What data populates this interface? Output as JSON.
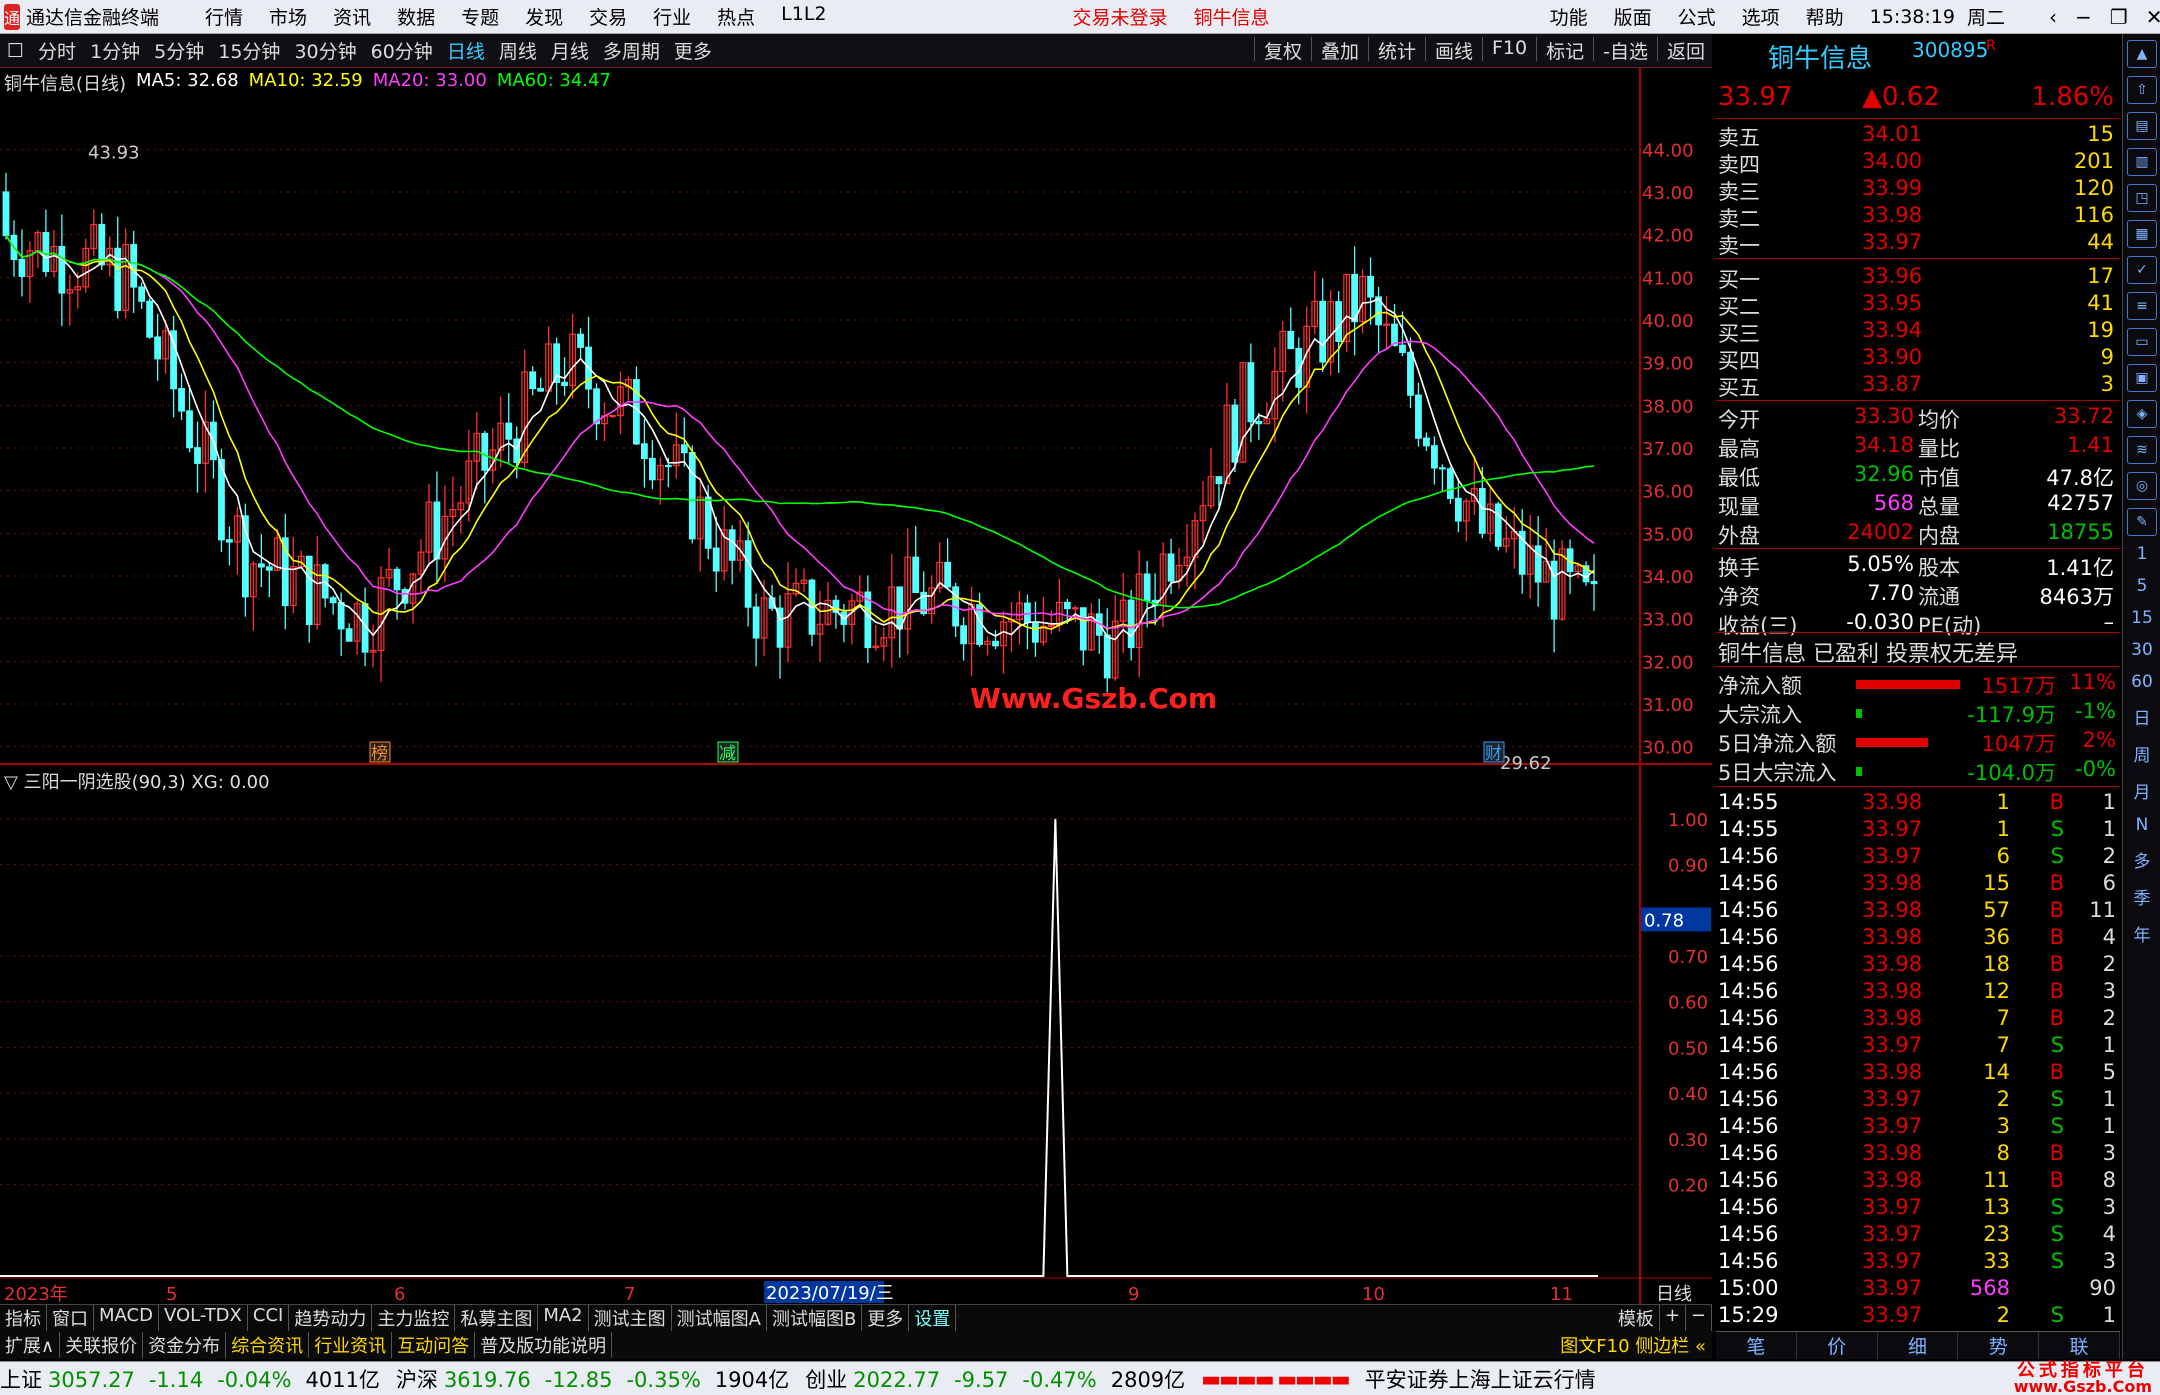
{
  "menubar": {
    "app_title": "通达信金融终端",
    "items": [
      "行情",
      "市场",
      "资讯",
      "数据",
      "专题",
      "发现",
      "交易",
      "行业",
      "热点",
      "L1L2"
    ],
    "login": "交易未登录",
    "stock": "铜牛信息",
    "right_items": [
      "功能",
      "版面",
      "公式",
      "选项",
      "帮助"
    ],
    "time": "15:38:19",
    "weekday": "周二"
  },
  "toolbar": {
    "periods": [
      "分时",
      "1分钟",
      "5分钟",
      "15分钟",
      "30分钟",
      "60分钟",
      "日线",
      "周线",
      "月线",
      "多周期",
      "更多"
    ],
    "active": "日线",
    "tools": [
      "复权",
      "叠加",
      "统计",
      "画线",
      "F10",
      "标记",
      "-自选",
      "返回"
    ]
  },
  "main_chart": {
    "title": "铜牛信息(日线)",
    "ma": [
      {
        "label": "MA5: 32.68",
        "color": "#ffffff"
      },
      {
        "label": "MA10: 32.59",
        "color": "#ffff00"
      },
      {
        "label": "MA20: 33.00",
        "color": "#ff3cff"
      },
      {
        "label": "MA60: 34.47",
        "color": "#00ff00"
      }
    ],
    "high_label": "43.93",
    "low_label": "29.62",
    "marker1": "榜",
    "marker2": "减",
    "marker3": "财",
    "watermark": "Www.Gszb.Com"
  },
  "indicator": {
    "title": "三阳一阴选股(90,3) XG: 0.00",
    "current": "0.78"
  },
  "chart_data": [
    {
      "type": "candlestick",
      "title": "铜牛信息(日线)",
      "ylim": [
        29.5,
        44.5
      ],
      "y_ticks": [
        "44.00",
        "43.00",
        "42.00",
        "41.00",
        "40.00",
        "39.00",
        "38.00",
        "37.00",
        "36.00",
        "35.00",
        "34.00",
        "33.00",
        "32.00",
        "31.00",
        "30.00"
      ],
      "x_labels": [
        "2023年",
        "5",
        "6",
        "7",
        "8",
        "9",
        "10",
        "11"
      ],
      "cursor_date": "2023/07/19/三",
      "series": [
        {
          "name": "MA5",
          "color": "#ffffff"
        },
        {
          "name": "MA10",
          "color": "#ffff00"
        },
        {
          "name": "MA20",
          "color": "#ff3cff"
        },
        {
          "name": "MA60",
          "color": "#00ff00"
        }
      ],
      "high": 43.93,
      "low": 29.62
    },
    {
      "type": "line",
      "title": "三阳一阴选股(90,3)",
      "ylim": [
        0,
        1.05
      ],
      "y_ticks": [
        "1.00",
        "0.90",
        "0.70",
        "0.60",
        "0.50",
        "0.40",
        "0.30",
        "0.20"
      ],
      "series": [
        {
          "name": "XG",
          "peak_index": 0.66,
          "peak_value": 1.0
        }
      ]
    }
  ],
  "quote": {
    "name": "铜牛信息",
    "code": "300895",
    "r": "R",
    "price": "33.97",
    "change": "▲0.62",
    "pct": "1.86%",
    "asks": [
      {
        "l": "卖五",
        "p": "34.01",
        "v": "15"
      },
      {
        "l": "卖四",
        "p": "34.00",
        "v": "201"
      },
      {
        "l": "卖三",
        "p": "33.99",
        "v": "120"
      },
      {
        "l": "卖二",
        "p": "33.98",
        "v": "116"
      },
      {
        "l": "卖一",
        "p": "33.97",
        "v": "44"
      }
    ],
    "bids": [
      {
        "l": "买一",
        "p": "33.96",
        "v": "17"
      },
      {
        "l": "买二",
        "p": "33.95",
        "v": "41"
      },
      {
        "l": "买三",
        "p": "33.94",
        "v": "19"
      },
      {
        "l": "买四",
        "p": "33.90",
        "v": "9"
      },
      {
        "l": "买五",
        "p": "33.87",
        "v": "3"
      }
    ],
    "stats": [
      {
        "a": "今开",
        "b": "33.30",
        "c": "均价",
        "d": "33.72",
        "bc": "#e00000",
        "dc": "#e00000"
      },
      {
        "a": "最高",
        "b": "34.18",
        "c": "量比",
        "d": "1.41",
        "bc": "#e00000",
        "dc": "#e00000"
      },
      {
        "a": "最低",
        "b": "32.96",
        "c": "市值",
        "d": "47.8亿",
        "bc": "#00c000",
        "dc": "#ffffff"
      },
      {
        "a": "现量",
        "b": "568",
        "c": "总量",
        "d": "42757",
        "bc": "#ff3cff",
        "dc": "#ffffff"
      },
      {
        "a": "外盘",
        "b": "24002",
        "c": "内盘",
        "d": "18755",
        "bc": "#e00000",
        "dc": "#00c000"
      }
    ],
    "stats2": [
      {
        "a": "换手",
        "b": "5.05%",
        "c": "股本",
        "d": "1.41亿"
      },
      {
        "a": "净资",
        "b": "7.70",
        "c": "流通",
        "d": "8463万"
      },
      {
        "a": "收益(三)",
        "b": "-0.030",
        "c": "PE(动)",
        "d": "–"
      }
    ],
    "info": "铜牛信息 已盈利 投票权无差异",
    "flows": [
      {
        "l": "净流入额",
        "v": "1517万",
        "p": "11%",
        "w": 104,
        "c": "#e00000"
      },
      {
        "l": "大宗流入",
        "v": "-117.9万",
        "p": "-1%",
        "w": 6,
        "c": "#00c000"
      },
      {
        "l": "5日净流入额",
        "v": "1047万",
        "p": "2%",
        "w": 72,
        "c": "#e00000"
      },
      {
        "l": "5日大宗流入",
        "v": "-104.0万",
        "p": "-0%",
        "w": 6,
        "c": "#00c000"
      }
    ],
    "ticks": [
      {
        "t": "14:55",
        "p": "33.98",
        "v": "1",
        "s": "B",
        "n": "1"
      },
      {
        "t": "14:55",
        "p": "33.97",
        "v": "1",
        "s": "S",
        "n": "1"
      },
      {
        "t": "14:56",
        "p": "33.97",
        "v": "6",
        "s": "S",
        "n": "2"
      },
      {
        "t": "14:56",
        "p": "33.98",
        "v": "15",
        "s": "B",
        "n": "6"
      },
      {
        "t": "14:56",
        "p": "33.98",
        "v": "57",
        "s": "B",
        "n": "11"
      },
      {
        "t": "14:56",
        "p": "33.98",
        "v": "36",
        "s": "B",
        "n": "4"
      },
      {
        "t": "14:56",
        "p": "33.98",
        "v": "18",
        "s": "B",
        "n": "2"
      },
      {
        "t": "14:56",
        "p": "33.98",
        "v": "12",
        "s": "B",
        "n": "3"
      },
      {
        "t": "14:56",
        "p": "33.98",
        "v": "7",
        "s": "B",
        "n": "2"
      },
      {
        "t": "14:56",
        "p": "33.97",
        "v": "7",
        "s": "S",
        "n": "1"
      },
      {
        "t": "14:56",
        "p": "33.98",
        "v": "14",
        "s": "B",
        "n": "5"
      },
      {
        "t": "14:56",
        "p": "33.97",
        "v": "2",
        "s": "S",
        "n": "1"
      },
      {
        "t": "14:56",
        "p": "33.97",
        "v": "3",
        "s": "S",
        "n": "1"
      },
      {
        "t": "14:56",
        "p": "33.98",
        "v": "8",
        "s": "B",
        "n": "3"
      },
      {
        "t": "14:56",
        "p": "33.98",
        "v": "11",
        "s": "B",
        "n": "8"
      },
      {
        "t": "14:56",
        "p": "33.97",
        "v": "13",
        "s": "S",
        "n": "3"
      },
      {
        "t": "14:56",
        "p": "33.97",
        "v": "23",
        "s": "S",
        "n": "4"
      },
      {
        "t": "14:56",
        "p": "33.97",
        "v": "33",
        "s": "S",
        "n": "3"
      },
      {
        "t": "15:00",
        "p": "33.97",
        "v": "568",
        "s": "",
        "n": "90"
      },
      {
        "t": "15:29",
        "p": "33.97",
        "v": "2",
        "s": "S",
        "n": "1"
      }
    ],
    "tabs": [
      "笔",
      "价",
      "细",
      "势",
      "联"
    ]
  },
  "sidebar": {
    "labels": [
      "1",
      "5",
      "15",
      "30",
      "60",
      "日",
      "周",
      "月",
      "N",
      "多",
      "季",
      "年"
    ]
  },
  "bottom": {
    "tabs1": [
      "指标",
      "窗口",
      "MACD",
      "VOL-TDX",
      "CCI",
      "趋势动力",
      "主力监控",
      "私募主图",
      "MA2",
      "测试主图",
      "测试幅图A",
      "测试幅图B",
      "更多",
      "设置"
    ],
    "right1": [
      "模板",
      "+",
      "−"
    ],
    "tabs2": [
      "扩展∧",
      "关联报价",
      "资金分布",
      "综合资讯",
      "行业资讯",
      "互动问答",
      "普及版功能说明"
    ],
    "right2": "图文F10 侧边栏 «"
  },
  "status": {
    "sh": {
      "n": "上证",
      "v": "3057.27",
      "c": "-1.14",
      "p": "-0.04%",
      "a": "4011亿"
    },
    "sz": {
      "n": "沪深",
      "v": "3619.76",
      "c": "-12.85",
      "p": "-0.35%",
      "a": "1904亿"
    },
    "cy": {
      "n": "创业",
      "v": "2022.77",
      "c": "-9.57",
      "p": "-0.47%",
      "a": "2809亿"
    },
    "broker": "平安证券上海上证云行情",
    "logo": "公式指标平台",
    "logo_url": "www.Gszb.Com"
  }
}
